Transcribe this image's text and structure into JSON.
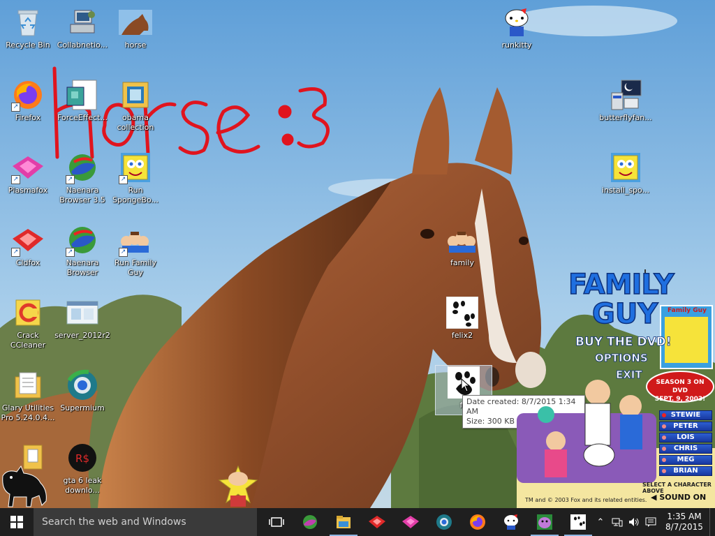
{
  "desktop": {
    "icons": [
      {
        "label": "Recycle Bin",
        "icon": "recycle-bin-icon"
      },
      {
        "label": "Collabnetio...",
        "icon": "computer-icon"
      },
      {
        "label": "horse",
        "icon": "horse-image-icon"
      },
      {
        "label": "runkitty",
        "icon": "hello-kitty-icon"
      },
      {
        "label": "Firefox",
        "icon": "firefox-icon"
      },
      {
        "label": "ForceEffect...",
        "icon": "installer-icon"
      },
      {
        "label": "obama collection",
        "icon": "archive-icon"
      },
      {
        "label": "butterflyfan...",
        "icon": "setup-program-icon"
      },
      {
        "label": "Plasmafox",
        "icon": "plasmafox-icon"
      },
      {
        "label": "Naenara Browser 3.5",
        "icon": "naenara-browser-icon"
      },
      {
        "label": "Run SpongeBo...",
        "icon": "spongebob-icon"
      },
      {
        "label": "install_spo...",
        "icon": "spongebob-installer-icon"
      },
      {
        "label": "Cldfox",
        "icon": "cldfox-icon"
      },
      {
        "label": "Naenara Browser",
        "icon": "naenara-browser-icon"
      },
      {
        "label": "Run Family Guy",
        "icon": "family-guy-icon"
      },
      {
        "label": "family",
        "icon": "family-guy-icon"
      },
      {
        "label": "Crack CCleaner",
        "icon": "ccleaner-icon"
      },
      {
        "label": "server_2012r2",
        "icon": "server-window-icon"
      },
      {
        "label": "felix2",
        "icon": "paw-print-icon"
      },
      {
        "label": "fe",
        "icon": "paw-print-icon"
      },
      {
        "label": "Glary Utilities Pro 5.24.0.4...",
        "icon": "document-folder-icon"
      },
      {
        "label": "Supermium",
        "icon": "supermium-icon"
      },
      {
        "label": "...",
        "icon": "folder-icon"
      },
      {
        "label": "gta 6 leak downlo...",
        "icon": "ransom-icon"
      }
    ]
  },
  "wallpaper": {
    "handwriting": "horse :3"
  },
  "tooltip": {
    "date_created": "Date created: 8/7/2015 1:34 AM",
    "size": "Size: 300 KB"
  },
  "ad": {
    "title_line1": "FAMILY",
    "title_line2": "GUY",
    "buy": "BUY THE DVD!",
    "options": "OPTIONS",
    "exit": "EXIT",
    "season": "SEASON 3 ON DVD",
    "date": "SEPT. 9, 2003!",
    "dvd_label": "Family Guy",
    "characters": [
      "STEWIE",
      "PETER",
      "LOIS",
      "CHRIS",
      "MEG",
      "BRIAN"
    ],
    "select_hint": "SELECT A CHARACTER ABOVE",
    "copyright": "TM and © 2003 Fox and its related entities.",
    "sound": "SOUND ON"
  },
  "taskbar": {
    "search_placeholder": "Search the web and Windows",
    "apps": [
      "task-view-icon",
      "naenara-browser-icon",
      "file-explorer-icon",
      "cldfox-icon",
      "plasmafox-icon",
      "supermium-icon",
      "firefox-icon",
      "hello-kitty-icon",
      "purple-app-icon",
      "paw-print-icon"
    ],
    "tray_icons": [
      "chevron-up-icon",
      "network-icon",
      "volume-icon",
      "notifications-icon"
    ],
    "time": "1:35 AM",
    "date": "8/7/2015"
  },
  "colors": {
    "taskbar": "#1f1f1f",
    "search_box": "#3a3a3a",
    "handwriting": "#e0141e",
    "ad_blue": "#1f6fe0"
  }
}
